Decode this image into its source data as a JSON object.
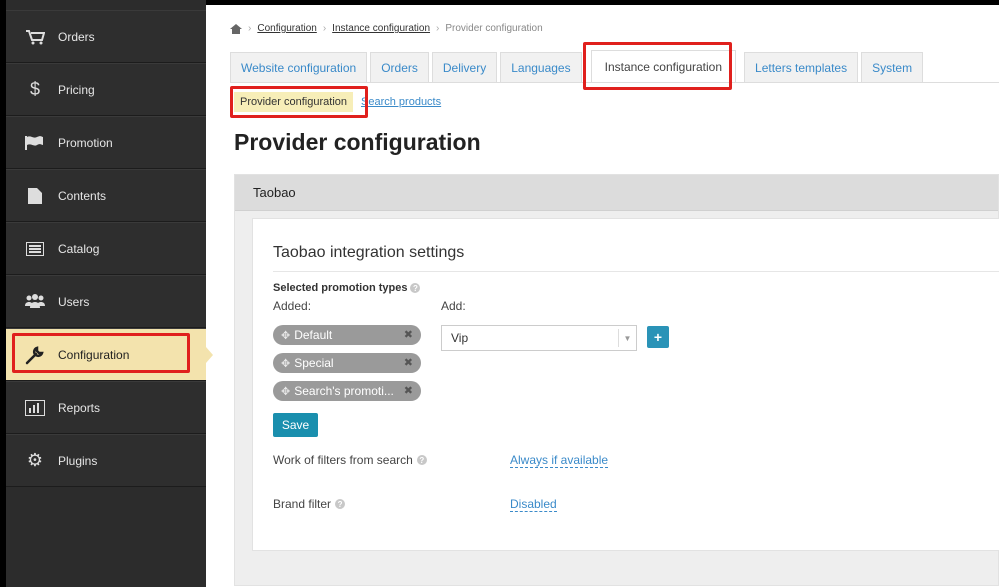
{
  "sidebar": {
    "items": [
      {
        "label": "Orders",
        "icon": "cart-icon"
      },
      {
        "label": "Pricing",
        "icon": "dollar-icon"
      },
      {
        "label": "Promotion",
        "icon": "flag-icon"
      },
      {
        "label": "Contents",
        "icon": "document-icon"
      },
      {
        "label": "Catalog",
        "icon": "list-icon"
      },
      {
        "label": "Users",
        "icon": "users-icon"
      },
      {
        "label": "Configuration",
        "icon": "wrench-icon",
        "active": true
      },
      {
        "label": "Reports",
        "icon": "chart-icon"
      },
      {
        "label": "Plugins",
        "icon": "gear-icon"
      }
    ]
  },
  "breadcrumb": {
    "items": [
      "Configuration",
      "Instance configuration"
    ],
    "current": "Provider configuration"
  },
  "tabs": {
    "items": [
      "Website configuration",
      "Orders",
      "Delivery",
      "Languages",
      "Instance configuration",
      "Letters templates",
      "System"
    ],
    "active": "Instance configuration"
  },
  "subtabs": {
    "active": "Provider configuration",
    "other": "Search products"
  },
  "page": {
    "title": "Provider configuration"
  },
  "panel": {
    "header": "Taobao",
    "section_title": "Taobao integration settings",
    "promotion": {
      "label": "Selected promotion types",
      "added_label": "Added:",
      "add_label": "Add:",
      "chips": [
        "Default",
        "Special",
        "Search's promoti..."
      ],
      "select_value": "Vip",
      "plus": "+"
    },
    "save_label": "Save",
    "filters": {
      "label": "Work of filters from search",
      "value": "Always if available"
    },
    "brand": {
      "label": "Brand filter",
      "value": "Disabled"
    }
  },
  "colors": {
    "sidebar_bg": "#2c2c2c",
    "sidebar_active": "#f3e3ad",
    "link": "#3a8ac9",
    "primary_button": "#1a8fae",
    "highlight_box": "#e0201d"
  }
}
